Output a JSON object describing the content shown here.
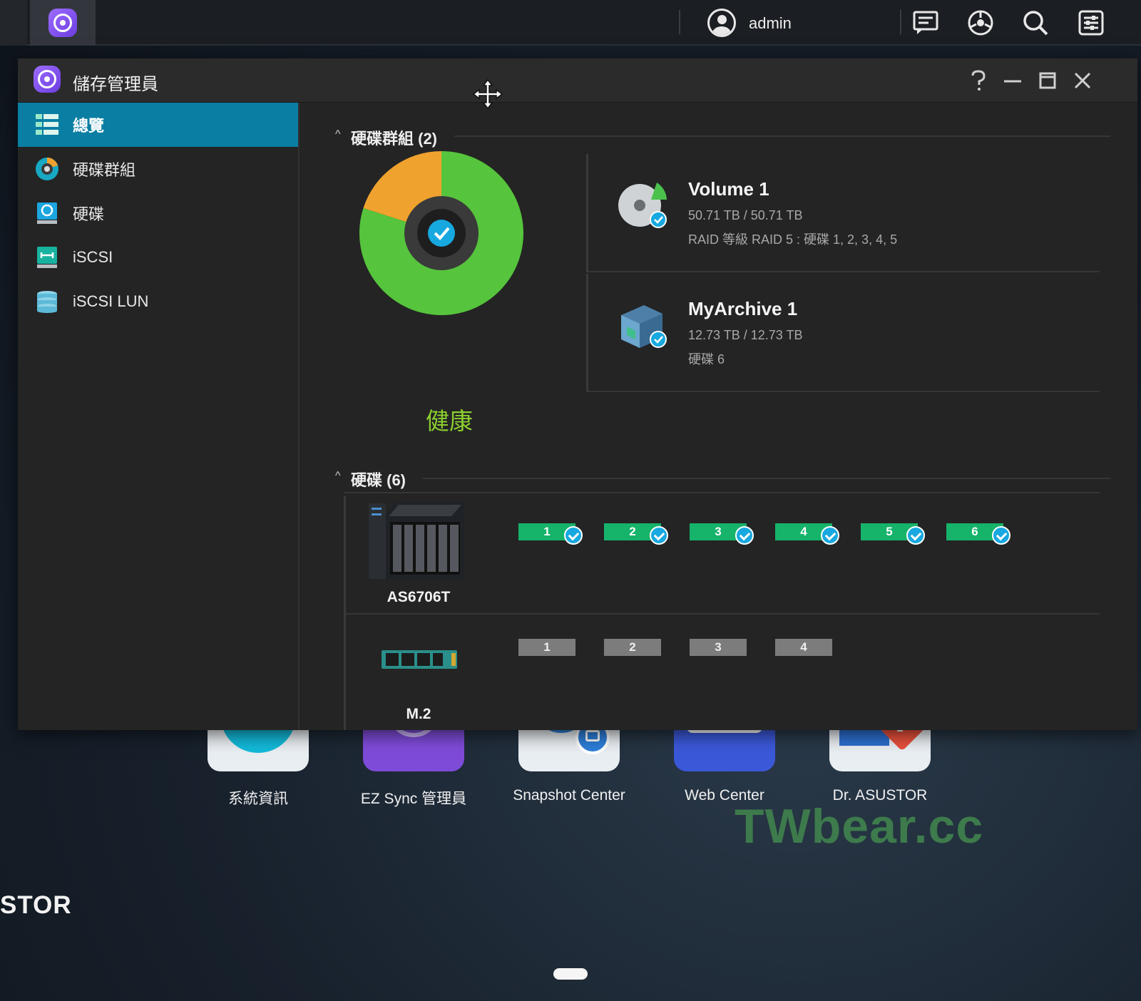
{
  "taskbar": {
    "username": "admin",
    "icons": [
      "storage-manager-icon",
      "user-icon",
      "notification-icon",
      "monitor-icon",
      "search-icon",
      "settings-icon"
    ]
  },
  "window": {
    "title": "儲存管理員",
    "icons": [
      "move-icon",
      "help-icon",
      "minimize-icon",
      "maximize-icon",
      "close-icon"
    ]
  },
  "sidebar": {
    "items": [
      {
        "label": "總覽",
        "icon": "overview-icon",
        "active": true
      },
      {
        "label": "硬碟群組",
        "icon": "volume-icon",
        "active": false
      },
      {
        "label": "硬碟",
        "icon": "disk-icon",
        "active": false
      },
      {
        "label": "iSCSI",
        "icon": "iscsi-icon",
        "active": false
      },
      {
        "label": "iSCSI LUN",
        "icon": "iscsi-lun-icon",
        "active": false
      }
    ]
  },
  "volumes_section": {
    "title": "硬碟群組 (2)",
    "health": "健康",
    "chart_data": {
      "type": "pie",
      "categories": [
        "Volume 1",
        "MyArchive 1"
      ],
      "values": [
        50.71,
        12.73
      ],
      "colors": [
        "#56c43c",
        "#f0a22e"
      ]
    },
    "volumes": [
      {
        "name": "Volume 1",
        "capacity": "50.71 TB / 50.71 TB",
        "desc": "RAID 等級 RAID 5 : 硬碟 1, 2, 3, 4, 5",
        "icon": "volume-pie-icon"
      },
      {
        "name": "MyArchive 1",
        "capacity": "12.73 TB / 12.73 TB",
        "desc": "硬碟 6",
        "icon": "myarchive-icon"
      }
    ]
  },
  "disks_section": {
    "title": "硬碟 (6)",
    "devices": [
      {
        "name": "AS6706T",
        "bays": [
          "1",
          "2",
          "3",
          "4",
          "5",
          "6"
        ],
        "status": "ok"
      },
      {
        "name": "M.2",
        "bays": [
          "1",
          "2",
          "3",
          "4"
        ],
        "status": "empty"
      }
    ]
  },
  "desktop": {
    "apps": [
      {
        "label": "系統資訊",
        "color": "#e9eef2"
      },
      {
        "label": "EZ Sync 管理員",
        "color": "#7e4bd8"
      },
      {
        "label": "Snapshot Center",
        "color": "#e9eef2"
      },
      {
        "label": "Web Center",
        "color": "#3b58d8"
      },
      {
        "label": "Dr. ASUSTOR",
        "color": "#e9eef2"
      }
    ],
    "brand": "STOR",
    "watermark": "TWbear.cc"
  },
  "colors": {
    "accent": "#0a7ea3",
    "healthy": "#8ccf2f",
    "disk_ok": "#16b36b",
    "disk_empty": "#7c7c7c",
    "check": "#17a8e0"
  }
}
